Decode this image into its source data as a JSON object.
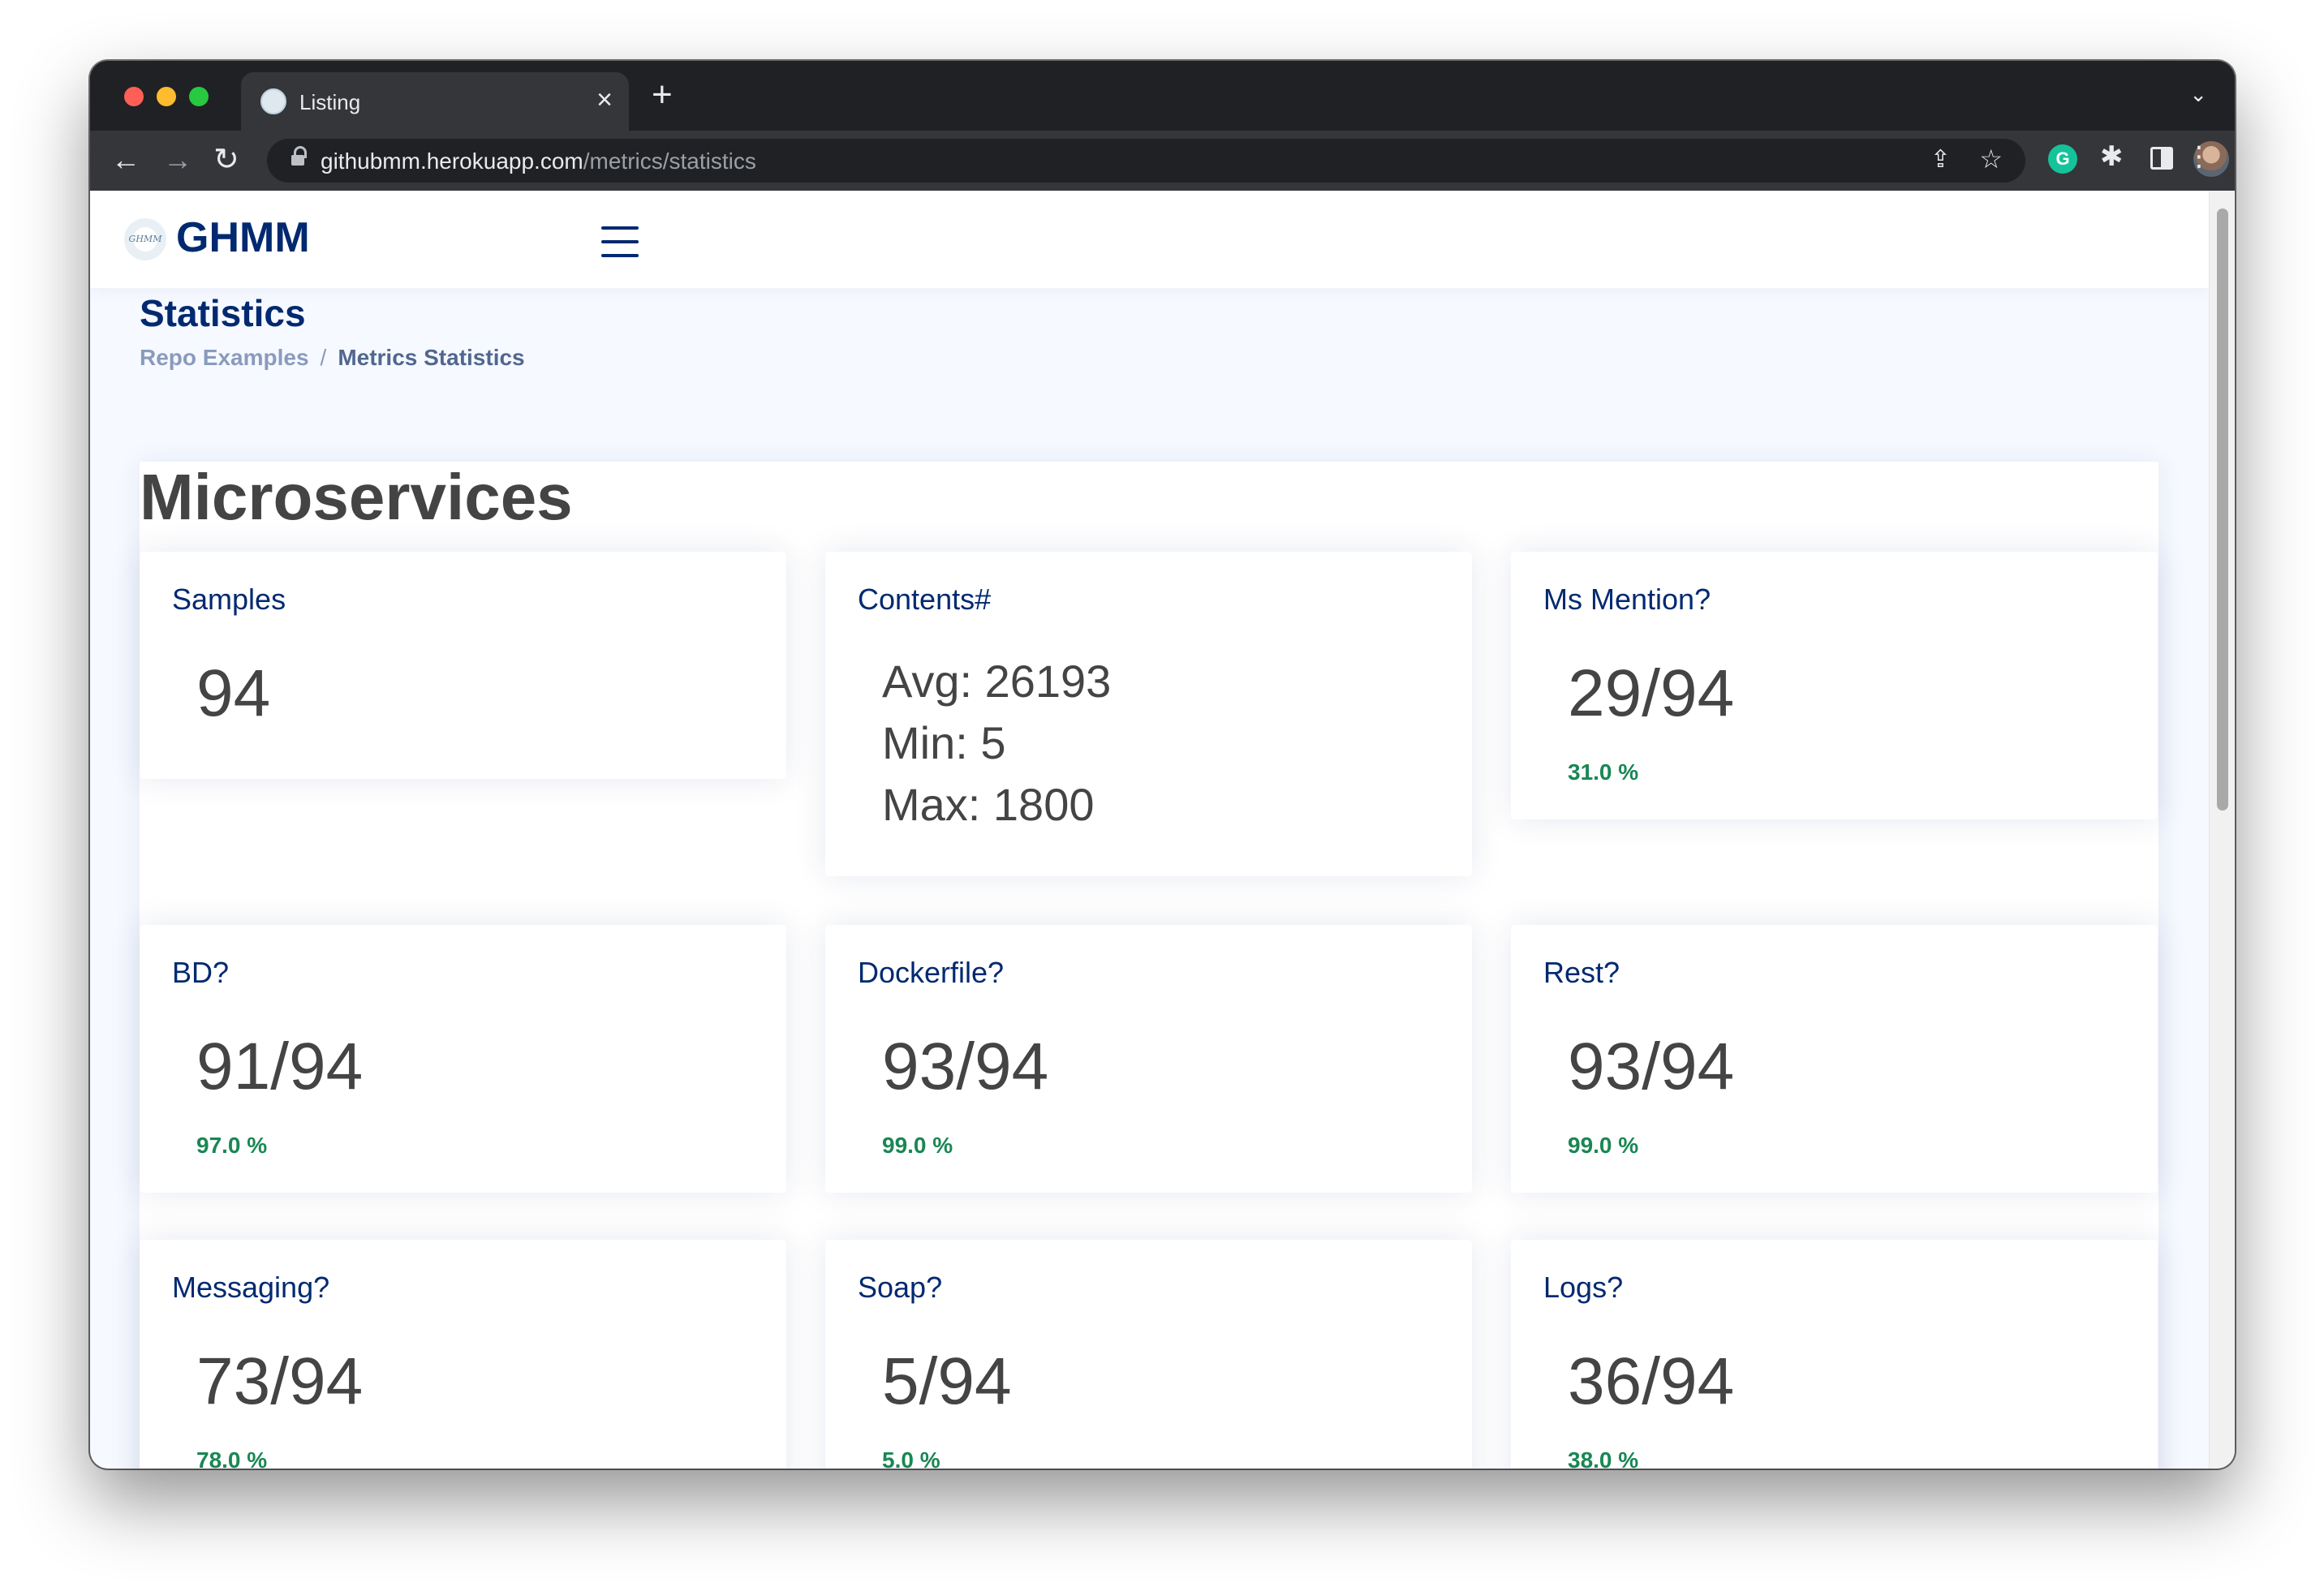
{
  "browser": {
    "tab_title": "Listing",
    "tab_close": "×",
    "new_tab": "+",
    "tab_overflow": "⌄",
    "url_host": "githubmm.herokuapp.com",
    "url_path": "/metrics/statistics",
    "back": "←",
    "forward": "→",
    "reload": "↻",
    "share": "⇪",
    "star": "☆",
    "grammarly": "G",
    "extensions": "✱",
    "menu": "⋮"
  },
  "header": {
    "logo_mark": "GHMM",
    "logo_text": "GHMM"
  },
  "page": {
    "title": "Statistics",
    "breadcrumb": [
      "Repo Examples",
      "Metrics Statistics"
    ],
    "breadcrumb_sep": "/"
  },
  "section": {
    "title": "Microservices"
  },
  "cards": {
    "samples": {
      "title": "Samples",
      "value": "94"
    },
    "contents": {
      "title": "Contents#",
      "avg": "Avg: 26193",
      "min": "Min: 5",
      "max": "Max: 1800"
    },
    "ms_mention": {
      "title": "Ms Mention?",
      "value": "29/94",
      "pct": "31.0 %"
    },
    "bd": {
      "title": "BD?",
      "value": "91/94",
      "pct": "97.0 %"
    },
    "dockerfile": {
      "title": "Dockerfile?",
      "value": "93/94",
      "pct": "99.0 %"
    },
    "rest": {
      "title": "Rest?",
      "value": "93/94",
      "pct": "99.0 %"
    },
    "messaging": {
      "title": "Messaging?",
      "value": "73/94",
      "pct": "78.0 %"
    },
    "soap": {
      "title": "Soap?",
      "value": "5/94",
      "pct": "5.0 %"
    },
    "logs": {
      "title": "Logs?",
      "value": "36/94",
      "pct": "38.0 %"
    }
  },
  "colors": {
    "brand": "#012970",
    "success": "#198754",
    "text": "#444444"
  }
}
